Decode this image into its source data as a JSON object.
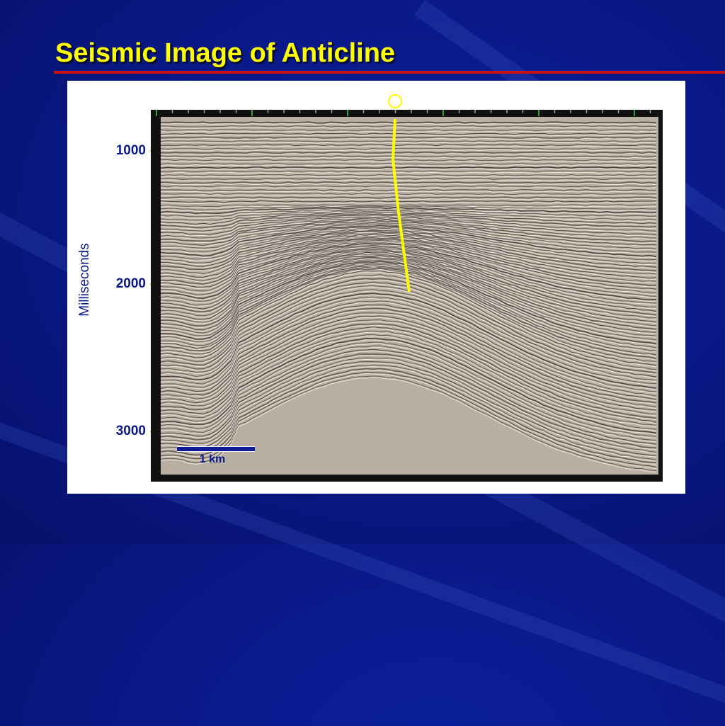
{
  "title": "Seismic Image of Anticline",
  "figure": {
    "y_axis_label": "Milliseconds",
    "y_ticks": [
      "1000",
      "2000",
      "3000"
    ],
    "scale_bar_label": "1 km",
    "well_icon": "circle-icon",
    "colors": {
      "background": "#0a1a8a",
      "title": "#ffff00",
      "rule": "#cc1111",
      "well_trace": "#ffff00",
      "axis_text": "#0b1a88"
    }
  }
}
